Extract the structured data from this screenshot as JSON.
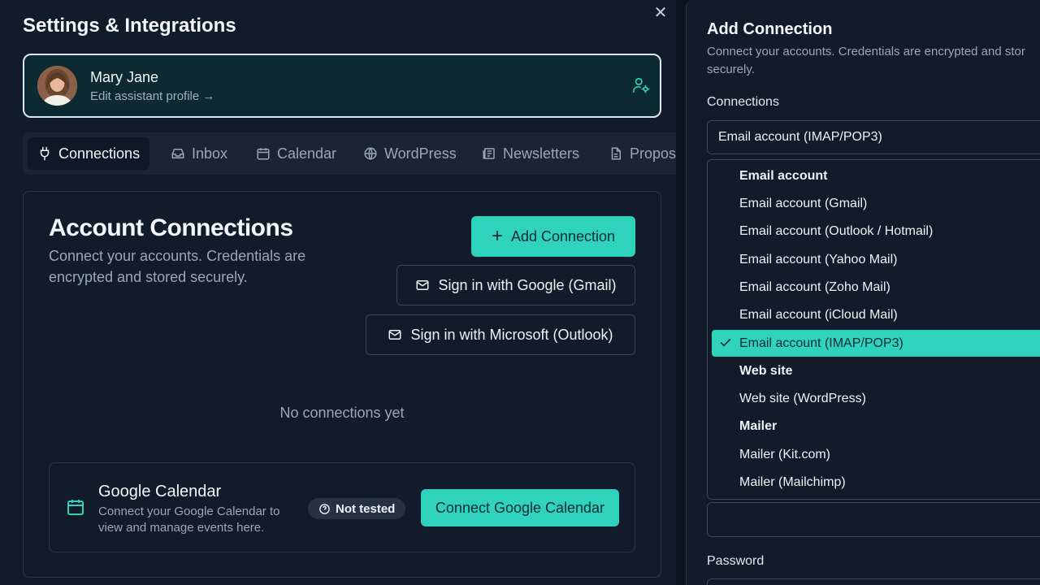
{
  "settings": {
    "title": "Settings & Integrations",
    "close_label": "✕"
  },
  "profile": {
    "name": "Mary Jane",
    "link": "Edit assistant profile →"
  },
  "tabs": [
    {
      "label": "Connections",
      "icon": "plug-icon",
      "active": true
    },
    {
      "label": "Inbox",
      "icon": "inbox-icon",
      "active": false
    },
    {
      "label": "Calendar",
      "icon": "calendar-icon",
      "active": false
    },
    {
      "label": "WordPress",
      "icon": "globe-icon",
      "active": false
    },
    {
      "label": "Newsletters",
      "icon": "newspaper-icon",
      "active": false
    },
    {
      "label": "Propos",
      "icon": "document-icon",
      "active": false
    }
  ],
  "main": {
    "title": "Account Connections",
    "subtitle": "Connect your accounts. Credentials are encrypted and stored securely.",
    "add_button": "Add Connection",
    "google_button": "Sign in with Google (Gmail)",
    "microsoft_button": "Sign in with Microsoft (Outlook)",
    "empty_text": "No connections yet"
  },
  "gcal": {
    "title": "Google Calendar",
    "subtitle": "Connect your Google Calendar to view and manage events here.",
    "badge": "Not tested",
    "button": "Connect Google Calendar"
  },
  "add_connection": {
    "title": "Add Connection",
    "subtitle_line1": "Connect your accounts. Credentials are encrypted and stor",
    "subtitle_line2": "securely.",
    "connections_label": "Connections",
    "selected_value": "Email account (IMAP/POP3)",
    "options": [
      {
        "label": "Email account",
        "type": "group"
      },
      {
        "label": "Email account (Gmail)",
        "type": "option"
      },
      {
        "label": "Email account (Outlook / Hotmail)",
        "type": "option"
      },
      {
        "label": "Email account (Yahoo Mail)",
        "type": "option"
      },
      {
        "label": "Email account (Zoho Mail)",
        "type": "option"
      },
      {
        "label": "Email account (iCloud Mail)",
        "type": "option"
      },
      {
        "label": "Email account (IMAP/POP3)",
        "type": "option",
        "selected": true
      },
      {
        "label": "Web site",
        "type": "group"
      },
      {
        "label": "Web site (WordPress)",
        "type": "option"
      },
      {
        "label": "Mailer",
        "type": "group"
      },
      {
        "label": "Mailer (Kit.com)",
        "type": "option"
      },
      {
        "label": "Mailer (Mailchimp)",
        "type": "option"
      }
    ],
    "password_label": "Password"
  },
  "colors": {
    "accent": "#2fd3bb",
    "background": "#111b2a",
    "border": "#3a4759"
  }
}
